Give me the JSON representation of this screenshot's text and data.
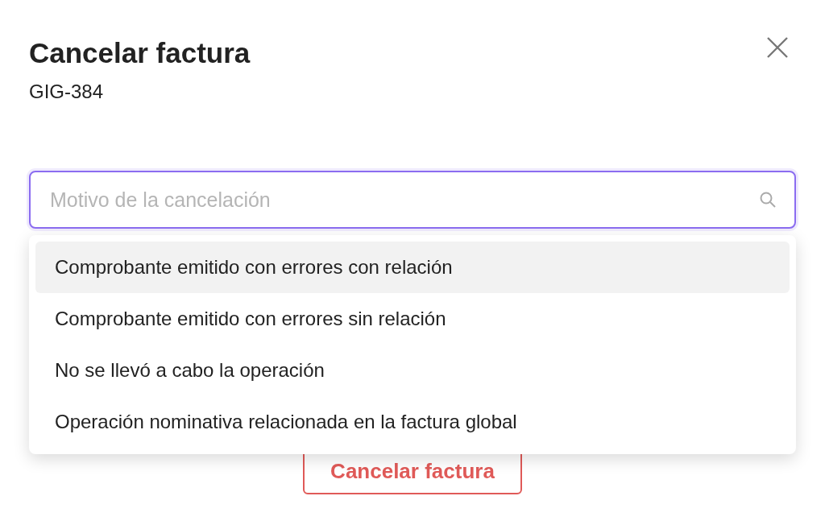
{
  "dialog": {
    "title": "Cancelar factura",
    "subtitle": "GIG-384"
  },
  "search": {
    "placeholder": "Motivo de la cancelación",
    "focused": true
  },
  "options": [
    {
      "label": "Comprobante emitido con errores con relación",
      "selected": true
    },
    {
      "label": "Comprobante emitido con errores sin relación",
      "selected": false
    },
    {
      "label": "No se llevó a cabo la operación",
      "selected": false
    },
    {
      "label": "Operación nominativa relacionada en la factura global",
      "selected": false
    }
  ],
  "button": {
    "label": "Cancelar factura"
  }
}
